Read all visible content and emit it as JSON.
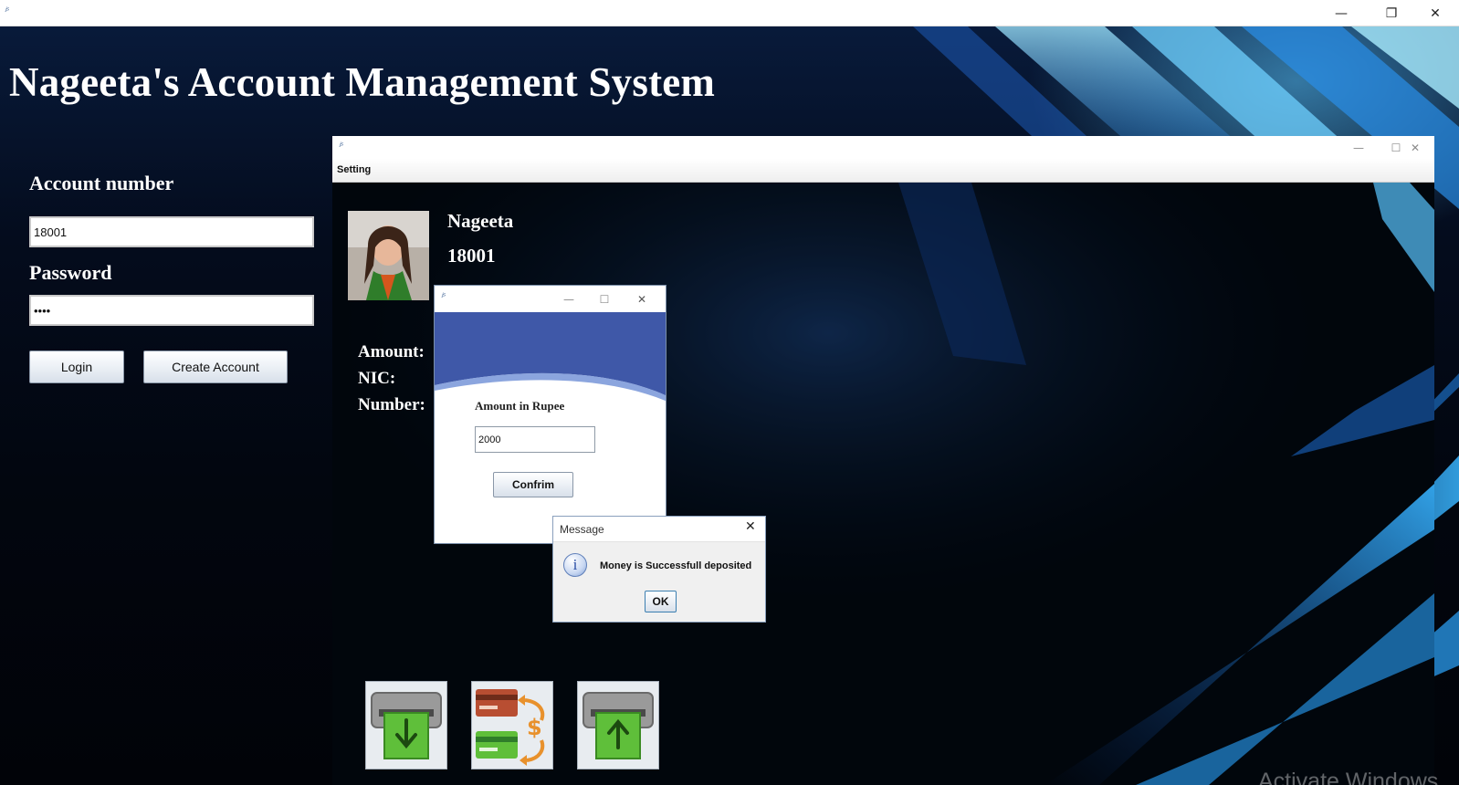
{
  "main_window": {
    "app_icon": "java-coffee-icon",
    "controls": {
      "minimize": "—",
      "restore": "❐",
      "close": "✕"
    }
  },
  "header": {
    "title": "Nageeta's Account Management System"
  },
  "login": {
    "account_label": "Account number",
    "account_value": "18001",
    "password_label": "Password",
    "password_value": "••••",
    "login_button": "Login",
    "create_button": "Create Account"
  },
  "dashboard": {
    "menu": [
      "Setting"
    ],
    "user_name": "Nageeta",
    "account_number": "18001",
    "fields": {
      "amount": "Amount:",
      "nic": "NIC:",
      "number": "Number:"
    },
    "actions": [
      "deposit-icon",
      "transfer-icon",
      "withdraw-icon"
    ]
  },
  "deposit_dialog": {
    "amount_label": "Amount in Rupee",
    "amount_value": "2000",
    "confirm_button": "Confrim"
  },
  "message_dialog": {
    "title": "Message",
    "text": "Money is Successfull deposited",
    "ok_button": "OK",
    "icon": "info-icon"
  },
  "watermark": "Activate Windows",
  "colors": {
    "background": "#02060f",
    "title_text": "#ffffff",
    "deposit_header": "#3f58a8",
    "button_border": "#8a97a8"
  }
}
